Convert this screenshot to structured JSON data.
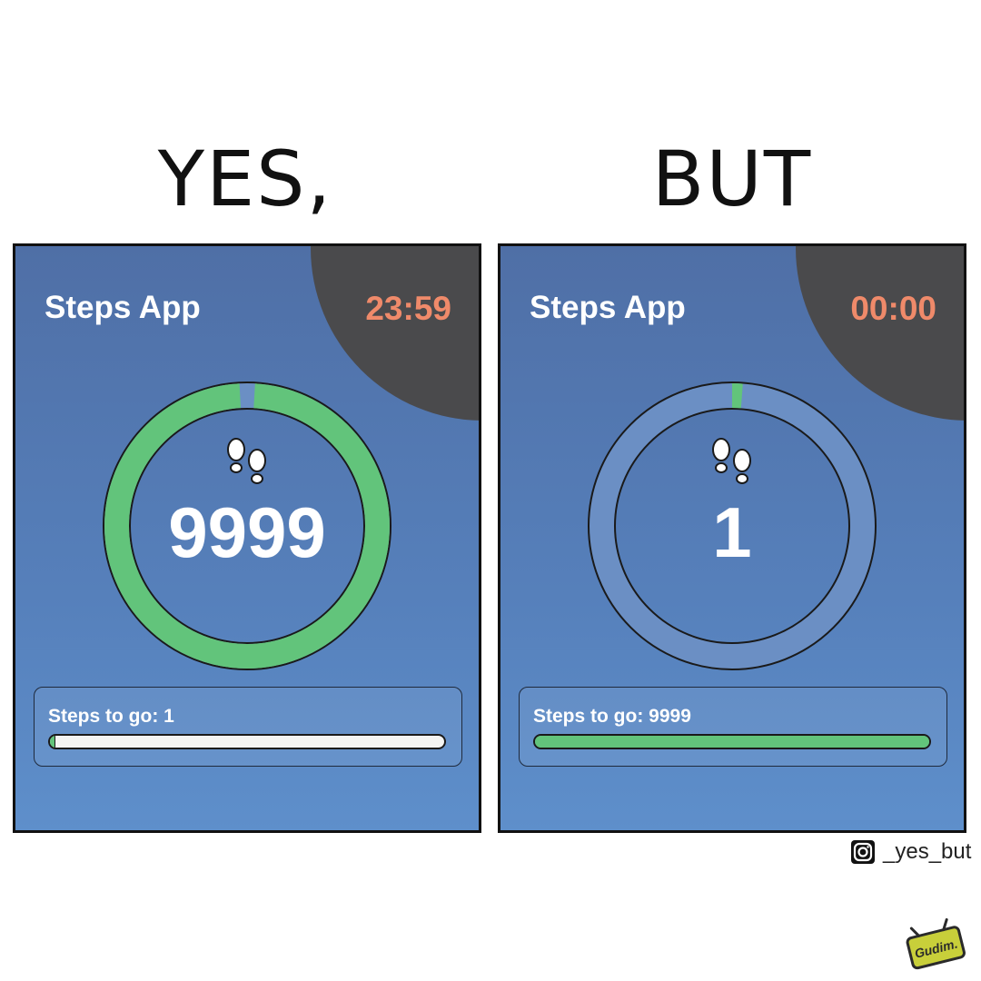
{
  "headings": {
    "left": "YES,",
    "right": "BUT"
  },
  "panels": [
    {
      "app_title": "Steps App",
      "clock": "23:59",
      "step_count": "9999",
      "goal_text": "Steps to go: 1",
      "ring_progress": 0.9999,
      "goal_bar_fill": 0.0001
    },
    {
      "app_title": "Steps App",
      "clock": "00:00",
      "step_count": "1",
      "goal_text": "Steps to go: 9999",
      "ring_progress": 0.0001,
      "goal_bar_fill": 0.9999
    }
  ],
  "credit": {
    "handle": "_yes_but",
    "icon": "instagram-icon"
  },
  "badge": {
    "text": "Gudim."
  },
  "colors": {
    "panel_blue": "#5680bb",
    "ring_green": "#62c47b",
    "ring_empty": "#6b8fc4",
    "clock_orange": "#ef8a6a",
    "shadow_gray": "#4a4a4c"
  }
}
